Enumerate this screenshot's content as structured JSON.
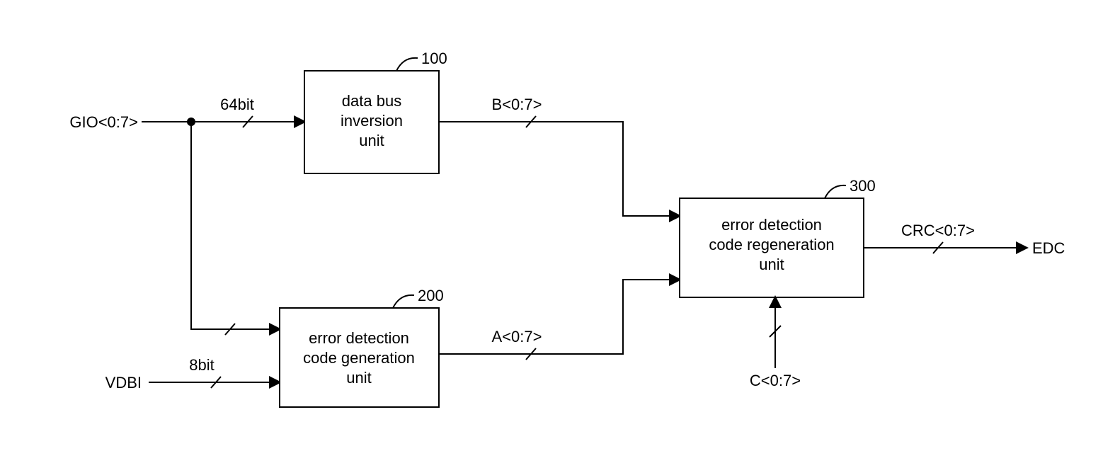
{
  "inputs": {
    "gio": "GIO<0:7>",
    "gio_width": "64bit",
    "vdbi": "VDBI",
    "vdbi_width": "8bit"
  },
  "signals": {
    "b": "B<0:7>",
    "a": "A<0:7>",
    "c": "C<0:7>",
    "crc": "CRC<0:7>"
  },
  "blocks": {
    "dbi": {
      "ref": "100",
      "line1": "data bus",
      "line2": "inversion",
      "line3": "unit"
    },
    "gen": {
      "ref": "200",
      "line1": "error detection",
      "line2": "code generation",
      "line3": "unit"
    },
    "regen": {
      "ref": "300",
      "line1": "error detection",
      "line2": "code regeneration",
      "line3": "unit"
    }
  },
  "output": {
    "edc": "EDC"
  }
}
